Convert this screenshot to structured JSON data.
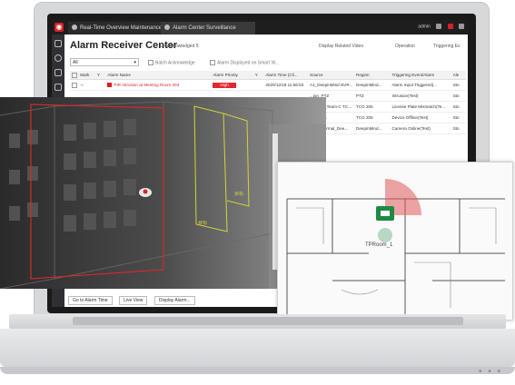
{
  "app": {
    "tabs": [
      {
        "label": "Real-Time Overview Maintenance"
      },
      {
        "label": "Alarm Center Surveillance"
      }
    ],
    "user": "admin"
  },
  "header": {
    "title": "Alarm Receiver Center",
    "unacknowledged": "Unacknowledged",
    "unack_count": "5",
    "display_related": "Display Related Video",
    "operation": "Operation",
    "triggering": "Triggering Ev"
  },
  "filters": {
    "select_value": "All",
    "batch_ack": "Batch Acknowledge",
    "display_smart": "Alarm Displayed on Smart W..."
  },
  "table": {
    "columns": [
      "Mark",
      "Y",
      "Alarm Name",
      "Alarm Priority",
      "Y",
      "Alarm Time (Cli...",
      "Source",
      "Region",
      "Triggering Event/Alarm",
      "Ale"
    ],
    "rows": [
      {
        "mark": "☆",
        "name": "PIR Intrusion at Meeting Room 203",
        "priority": "High",
        "time": "2020/12/19 11:56:03",
        "source": "A1_DeepinMind NVR...",
        "region": "DeepinMind...",
        "event": "Alarm Input Triggered(...",
        "ale": "Sto"
      },
      {
        "mark": "",
        "name": "",
        "priority": "",
        "time": "",
        "source": "...ion_PTZ",
        "region": "PTZ",
        "event": "Intrusion(Test)",
        "ale": "Sto"
      },
      {
        "mark": "",
        "name": "",
        "priority": "",
        "time": "",
        "source": "...cence_Team-C TC...",
        "region": "TCG 205",
        "event": "License Plate Mismatch(Te...",
        "ale": "Sto"
      },
      {
        "mark": "",
        "name": "",
        "priority": "",
        "time": "",
        "source": "...ISNR-1",
        "region": "TCG 205",
        "event": "Device Offline(Test)",
        "ale": "Sto"
      },
      {
        "mark": "",
        "name": "",
        "priority": "",
        "time": "",
        "source": "...00-Thermal_Dee...",
        "region": "DeepinMind...",
        "event": "Camera Online(Test)",
        "ale": "Sto"
      }
    ]
  },
  "buttons": {
    "go_to_alarm_time": "Go to Alarm Time",
    "live_view": "Live View",
    "display_alarm": "Display Alarm..."
  },
  "camera": {
    "zone_label_1": "目标",
    "zone_label_2": "目标"
  },
  "floorplan": {
    "room_label": "TPRoom_1"
  },
  "colors": {
    "accent_red": "#d71f26",
    "zone_yellow": "#d4d23a",
    "camera_green": "#1f8a44"
  },
  "icons": {
    "logo": "hik-logo-icon",
    "camera": "camera-icon"
  }
}
